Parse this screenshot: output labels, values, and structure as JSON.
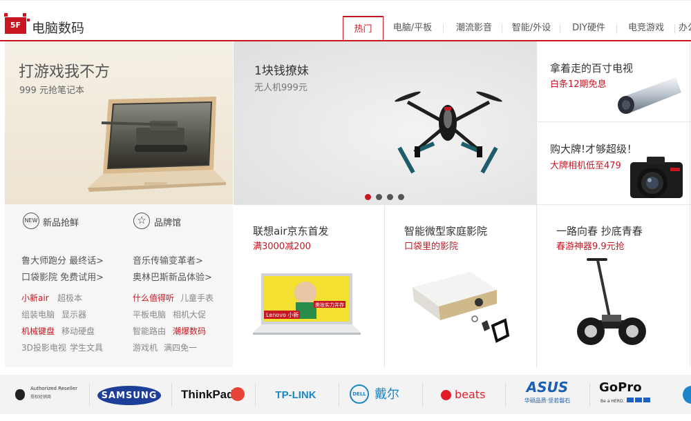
{
  "header": {
    "floor_badge": "5F",
    "floor_title": "电脑数码",
    "tabs": [
      {
        "label": "热门",
        "active": true
      },
      {
        "label": "电脑/平板"
      },
      {
        "label": "潮流影音"
      },
      {
        "label": "智能/外设"
      },
      {
        "label": "DIY硬件"
      },
      {
        "label": "电竞游戏"
      },
      {
        "label": "办公"
      }
    ]
  },
  "left_panel": {
    "hero_title": "打游戏我不方",
    "hero_sub": "999 元抢笔记本",
    "quick": [
      {
        "badge": "NEW",
        "label": "新品抢鲜"
      },
      {
        "label": "品牌馆"
      }
    ],
    "bold_links": [
      "鲁大师跑分 最终话>",
      "音乐传输变革者>",
      "口袋影院 免费试用>",
      "奥林巴斯新品体验>"
    ],
    "small_links": [
      [
        "小新air",
        "超极本",
        "什么值得听",
        "儿童手表"
      ],
      [
        "组装电脑",
        "显示器",
        "平板电脑",
        "相机大促"
      ],
      [
        "机械键盘",
        "移动硬盘",
        "智能路由",
        "潮爆数码"
      ],
      [
        "3D投影电视",
        "学生文具",
        "游戏机",
        "满四免一"
      ]
    ],
    "red_links": [
      "小新air",
      "什么值得听",
      "机械键盘",
      "潮爆数码"
    ]
  },
  "carousel": {
    "title": "1块钱撩妹",
    "sub": "无人机999元",
    "dots": 4,
    "active_dot": 1
  },
  "right_cards": [
    {
      "title": "拿着走的百寸电视",
      "sub": "白条12期免息"
    },
    {
      "title": "购大牌!才够超级！",
      "sub": "大牌相机低至479"
    }
  ],
  "cells": [
    {
      "title": "联想air京东首发",
      "sub": "满3000减200",
      "screen_text": "Lenovo 小新",
      "banner_text": "美妆实力并存"
    },
    {
      "title": "智能微型家庭影院",
      "sub": "口袋里的影院"
    },
    {
      "title": "一路向春 抄底青春",
      "sub": "春游神器9.9元抢"
    }
  ],
  "brands": [
    {
      "name": "Authorized Reseller",
      "sub": "授权经销商"
    },
    {
      "name": "SAMSUNG"
    },
    {
      "name": "ThinkPad"
    },
    {
      "name": "TP-LINK"
    },
    {
      "name": "DELL",
      "sub": "戴尔"
    },
    {
      "name": "beats"
    },
    {
      "name": "ASUS",
      "sub": "华硕品质·坚若磐石"
    },
    {
      "name": "GoPro",
      "sub": "Be a HERO."
    }
  ],
  "colors": {
    "accent": "#c81623",
    "text": "#333333",
    "muted": "#888888"
  }
}
